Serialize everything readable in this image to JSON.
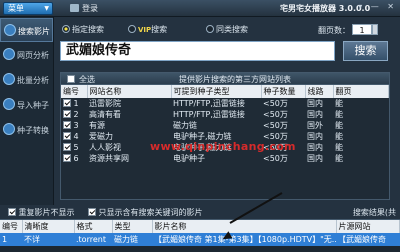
{
  "titlebar": {
    "menu_label": "菜单",
    "login_label": "登录",
    "app_title": "宅男宅女播放器 3.0.0.0",
    "window_controls": "▾ — ✕"
  },
  "sidebar": {
    "items": [
      {
        "label": "搜索影片",
        "icon": "search-icon",
        "active": true
      },
      {
        "label": "网页分析",
        "icon": "web-icon",
        "active": false
      },
      {
        "label": "批量分析",
        "icon": "batch-icon",
        "active": false
      },
      {
        "label": "导入种子",
        "icon": "import-icon",
        "active": false
      },
      {
        "label": "种子转换",
        "icon": "convert-icon",
        "active": false
      }
    ]
  },
  "search_options": {
    "specified": "指定搜索",
    "vip": "VIP搜索",
    "vip_prefix": "VIP",
    "vip_suffix": "搜索",
    "similar": "同类搜索",
    "pages_label": "翻页数：",
    "pages_value": "1"
  },
  "search": {
    "query": "武媚娘传奇",
    "button_label": "搜索"
  },
  "site_panel": {
    "select_all_label": "全选",
    "title": "提供影片搜索的第三方网站列表",
    "columns": [
      "编号",
      "网站名称",
      "可提到种子类型",
      "种子数量",
      "线路",
      "翻页"
    ],
    "rows": [
      {
        "id": "1",
        "name": "迅雷影院",
        "type": "HTTP/FTP,迅雷链接",
        "count": "<50万",
        "line": "国内",
        "page": "能"
      },
      {
        "id": "2",
        "name": "高清有看",
        "type": "HTTP/FTP,迅雷链接",
        "count": "<50万",
        "line": "国内",
        "page": "能"
      },
      {
        "id": "3",
        "name": "有源",
        "type": "磁力链",
        "count": "<50万",
        "line": "国外",
        "page": "能"
      },
      {
        "id": "4",
        "name": "爱磁力",
        "type": "电驴种子,磁力链",
        "count": "<50万",
        "line": "国内",
        "page": "能"
      },
      {
        "id": "5",
        "name": "人人影视",
        "type": "电驴种子,磁力链",
        "count": "<50万",
        "line": "国内",
        "page": "能"
      },
      {
        "id": "6",
        "name": "资源共享网",
        "type": "电驴种子",
        "count": "<50万",
        "line": "国内",
        "page": "能"
      }
    ]
  },
  "watermark": "www.qinpinchang.com",
  "options": {
    "duplicate_label": "重复影片不显示",
    "keyword_label": "只显示含有搜索关键词的影片",
    "results_label": "搜索结果(共"
  },
  "results": {
    "columns": [
      "编号",
      "清晰度",
      "格式",
      "类型",
      "影片名称",
      "片源网站"
    ],
    "rows": [
      {
        "id": "1",
        "quality": "不详",
        "format": ".torrent",
        "type": "磁力链",
        "name": "【武媚娘传奇 第1集-第3集】【1080p.HDTV】\"无...",
        "site": "【武媚娘传奇"
      }
    ]
  },
  "colors": {
    "accent": "#2f7fd6",
    "watermark": "#d62b2b",
    "vip": "#f1d64a"
  }
}
